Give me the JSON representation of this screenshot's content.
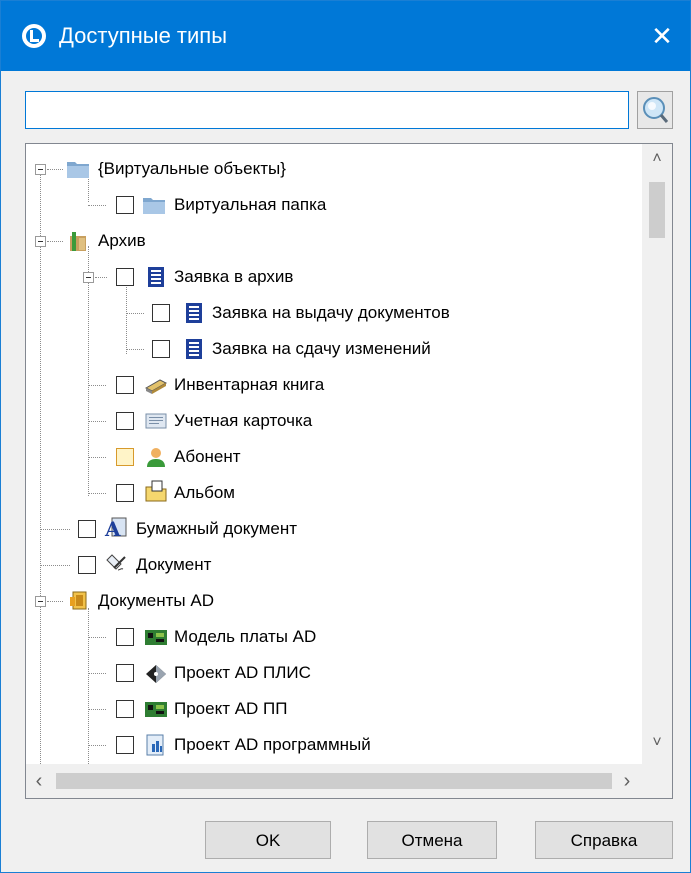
{
  "window": {
    "title": "Доступные типы",
    "close_symbol": "✕"
  },
  "search": {
    "value": "",
    "placeholder": ""
  },
  "tree": {
    "items": [
      {
        "label": "{Виртуальные объекты}",
        "level": 0,
        "expandable": true,
        "checkbox": false,
        "icon": "folder-icon"
      },
      {
        "label": "Виртуальная папка",
        "level": 1,
        "expandable": false,
        "checkbox": true,
        "icon": "folder-icon"
      },
      {
        "label": "Архив",
        "level": 0,
        "expandable": true,
        "checkbox": false,
        "icon": "archive-icon"
      },
      {
        "label": "Заявка в архив",
        "level": 1,
        "expandable": true,
        "checkbox": true,
        "icon": "document-icon"
      },
      {
        "label": "Заявка на выдачу документов",
        "level": 2,
        "expandable": false,
        "checkbox": true,
        "icon": "document-icon"
      },
      {
        "label": "Заявка на сдачу изменений",
        "level": 2,
        "expandable": false,
        "checkbox": true,
        "icon": "document-icon"
      },
      {
        "label": "Инвентарная книга",
        "level": 1,
        "expandable": false,
        "checkbox": true,
        "icon": "book-icon"
      },
      {
        "label": "Учетная карточка",
        "level": 1,
        "expandable": false,
        "checkbox": true,
        "icon": "card-icon"
      },
      {
        "label": "Абонент",
        "level": 1,
        "expandable": false,
        "checkbox": true,
        "icon": "user-icon",
        "highlighted": true
      },
      {
        "label": "Альбом",
        "level": 1,
        "expandable": false,
        "checkbox": true,
        "icon": "album-icon"
      },
      {
        "label": "Бумажный документ",
        "level": 0,
        "expandable": false,
        "checkbox": true,
        "icon": "paper-doc-icon"
      },
      {
        "label": "Документ",
        "level": 0,
        "expandable": false,
        "checkbox": true,
        "icon": "pen-doc-icon"
      },
      {
        "label": "Документы AD",
        "level": 0,
        "expandable": true,
        "checkbox": false,
        "icon": "ad-docs-icon"
      },
      {
        "label": "Модель платы AD",
        "level": 1,
        "expandable": false,
        "checkbox": true,
        "icon": "board-icon"
      },
      {
        "label": "Проект AD ПЛИС",
        "level": 1,
        "expandable": false,
        "checkbox": true,
        "icon": "chip-icon"
      },
      {
        "label": "Проект AD ПП",
        "level": 1,
        "expandable": false,
        "checkbox": true,
        "icon": "board-icon"
      },
      {
        "label": "Проект AD программный",
        "level": 1,
        "expandable": false,
        "checkbox": true,
        "icon": "program-icon"
      }
    ]
  },
  "scroll": {
    "up": "˄",
    "down": "˅",
    "left": "‹",
    "right": "›"
  },
  "buttons": {
    "ok": "OK",
    "cancel": "Отмена",
    "help": "Справка"
  },
  "colors": {
    "titlebar": "#0078d7",
    "focus_border": "#0078d7"
  }
}
